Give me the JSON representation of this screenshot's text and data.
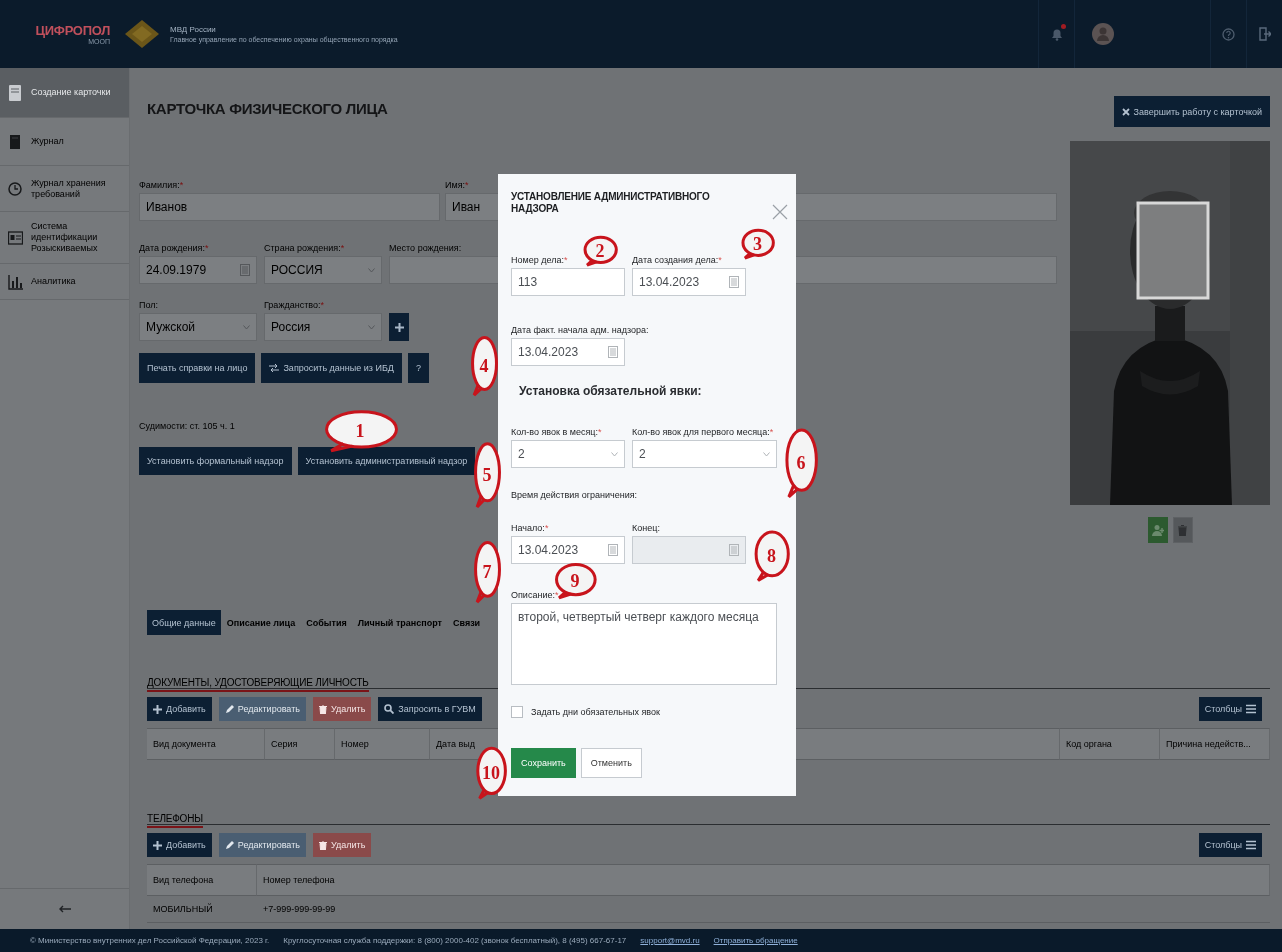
{
  "header": {
    "logo_title": "ЦИФРОПОЛ",
    "logo_subtitle": "МООП",
    "org_title": "МВД России",
    "org_subtitle": "Главное управление по обеспечению охраны общественного порядка",
    "has_unread": true
  },
  "sidebar": {
    "items": [
      {
        "label": "Создание карточки",
        "kind": "card",
        "selected": true
      },
      {
        "label": "Журнал",
        "kind": "book",
        "selected": false
      },
      {
        "label": "Журнал хранения требований",
        "kind": "clock",
        "selected": false
      },
      {
        "label": "Система идентификации Розыскиваемых",
        "kind": "id",
        "selected": false
      },
      {
        "label": "Аналитика",
        "kind": "chart",
        "selected": false
      }
    ]
  },
  "page": {
    "title": "КАРТОЧКА ФИЗИЧЕСКОГО ЛИЦА",
    "close_button": "Завершить работу с карточкой"
  },
  "form": {
    "rows": [
      [
        {
          "label": "Фамилия:",
          "mark": "*",
          "value": "Иванов",
          "kind": "text"
        },
        {
          "label": "Имя:",
          "mark": "*",
          "value": "Иван",
          "kind": "text"
        },
        {
          "kind": "text"
        }
      ],
      [
        {
          "label": "Дата рождения:",
          "mark": "*",
          "value": "24.09.1979",
          "kind": "date"
        },
        {
          "label": "Страна рождения:",
          "mark": "*",
          "value": "РОССИЯ",
          "kind": "select"
        },
        {
          "label": "Место рождения:",
          "kind": "text"
        }
      ],
      [
        {
          "label": "Пол:",
          "value": "Мужской",
          "kind": "select"
        },
        {
          "label": "Гражданство:",
          "mark": "*",
          "value": "Россия",
          "kind": "select"
        },
        {
          "kind": "add"
        }
      ]
    ],
    "actions": [
      {
        "label": "Печать справки на лицо",
        "kind": "plain"
      },
      {
        "label": "Запросить данные из ИБД",
        "kind": "sync"
      },
      {
        "label": "?",
        "kind": "plain"
      }
    ],
    "convictions": "Судимости: ст. 105 ч. 1",
    "supervision_buttons": [
      "Установить формальный надзор",
      "Установить административный надзор"
    ]
  },
  "tabs": [
    {
      "label": "Общие данные",
      "selected": true
    },
    {
      "label": "Описание лица",
      "selected": false
    },
    {
      "label": "События",
      "selected": false
    },
    {
      "label": "Личный транспорт",
      "selected": false
    },
    {
      "label": "Связи",
      "selected": false
    }
  ],
  "sections": [
    {
      "title": "ДОКУМЕНТЫ, УДОСТОВЕРЯЮЩИЕ ЛИЧНОСТЬ",
      "buttons": [
        {
          "label": "Добавить",
          "kind": "add",
          "disabled": false
        },
        {
          "label": "Редактировать",
          "kind": "edit",
          "disabled": true
        },
        {
          "label": "Удалить",
          "kind": "delete",
          "disabled": true
        },
        {
          "label": "Запросить в ГУВМ",
          "kind": "search",
          "disabled": false
        }
      ],
      "columns_button": "Столбцы",
      "table": {
        "columns": [
          "Вид документа",
          "Серия",
          "Номер",
          "Дата выд",
          "Код органа",
          "Причина недейств..."
        ]
      }
    },
    {
      "title": "ТЕЛЕФОНЫ",
      "buttons": [
        {
          "label": "Добавить",
          "kind": "add",
          "disabled": false
        },
        {
          "label": "Редактировать",
          "kind": "edit",
          "disabled": true
        },
        {
          "label": "Удалить",
          "kind": "delete",
          "disabled": true
        }
      ],
      "columns_button": "Столбцы",
      "table": {
        "columns": [
          "Вид телефона",
          "Номер телефона"
        ],
        "rows": [
          [
            "МОБИЛЬНЫЙ",
            "+7-999-999-99-99"
          ]
        ]
      }
    }
  ],
  "modal": {
    "title": "УСТАНОВЛЕНИЕ АДМИНИСТРАТИВНОГО НАДЗОРА",
    "case_number": {
      "label": "Номер дела:",
      "mark": "*",
      "value": "113",
      "kind": "text"
    },
    "case_date": {
      "label": "Дата создания дела:",
      "mark": "*",
      "value": "13.04.2023",
      "kind": "date"
    },
    "start_date": {
      "label": "Дата факт. начала адм. надзора:",
      "value": "13.04.2023",
      "kind": "date"
    },
    "attendance_heading": "Установка обязательной явки:",
    "per_month": {
      "label": "Кол-во явок в месяц:",
      "mark": "*",
      "value": "2",
      "kind": "select"
    },
    "first_month": {
      "label": "Кол-во явок для первого месяца:",
      "mark": "*",
      "value": "2",
      "kind": "select"
    },
    "period_heading": "Время действия ограничения:",
    "begin": {
      "label": "Начало:",
      "mark": "*",
      "value": "13.04.2023",
      "kind": "date"
    },
    "end": {
      "label": "Конец:",
      "kind": "date",
      "disabled": true
    },
    "description": {
      "label": "Описание:",
      "mark": "*",
      "value": "второй, четвертый четверг каждого месяца",
      "kind": "area"
    },
    "set_days": {
      "label": "Задать дни обязательных явок",
      "checked": false
    },
    "buttons": [
      {
        "label": "Сохранить",
        "kind": "primary"
      },
      {
        "label": "Отменить",
        "kind": "secondary"
      }
    ]
  },
  "annotations": [
    "1",
    "2",
    "3",
    "4",
    "5",
    "6",
    "7",
    "8",
    "9",
    "10"
  ],
  "footer": {
    "items": [
      {
        "text": "© Министерство внутренних дел Российской Федерации, 2023 г.",
        "kind": "text"
      },
      {
        "text": "Круглосуточная служба поддержки: 8 (800) 2000-402 (звонок бесплатный), 8 (495) 667-67-17",
        "kind": "text"
      },
      {
        "text": "support@mvd.ru",
        "kind": "link"
      },
      {
        "text": "Отправить обращение",
        "kind": "link"
      }
    ]
  }
}
